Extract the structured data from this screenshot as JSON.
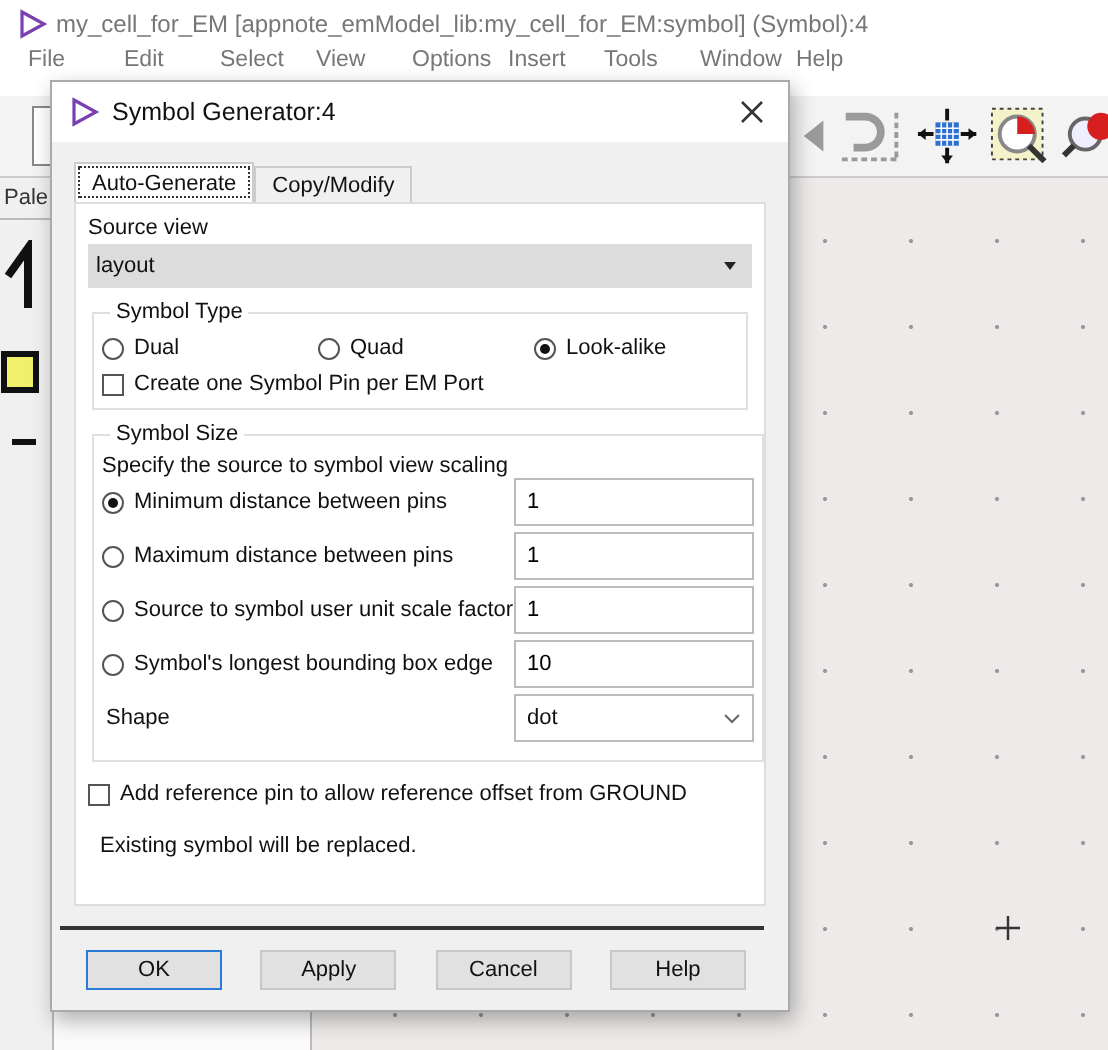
{
  "app_window": {
    "title": "my_cell_for_EM [appnote_emModel_lib:my_cell_for_EM:symbol] (Symbol):4",
    "menu": [
      "File",
      "Edit",
      "Select",
      "View",
      "Options",
      "Insert",
      "Tools",
      "Window",
      "Help"
    ],
    "palette_tab": "Pale"
  },
  "dialog": {
    "title": "Symbol Generator:4",
    "tabs": [
      {
        "label": "Auto-Generate",
        "selected": true
      },
      {
        "label": "Copy/Modify",
        "selected": false
      }
    ],
    "source_view": {
      "label": "Source view",
      "value": "layout"
    },
    "symbol_type": {
      "title": "Symbol Type",
      "options": [
        {
          "label": "Dual",
          "selected": false
        },
        {
          "label": "Quad",
          "selected": false
        },
        {
          "label": "Look-alike",
          "selected": true
        }
      ],
      "pin_per_port": {
        "label": "Create one Symbol Pin per EM Port",
        "checked": false
      }
    },
    "symbol_size": {
      "title": "Symbol Size",
      "hint": "Specify the source to symbol view scaling",
      "options": [
        {
          "label": "Minimum distance between pins",
          "selected": true,
          "value": "1"
        },
        {
          "label": "Maximum distance between pins",
          "selected": false,
          "value": "1"
        },
        {
          "label": "Source to symbol user unit scale factor",
          "selected": false,
          "value": "1"
        },
        {
          "label": "Symbol's longest bounding box edge",
          "selected": false,
          "value": "10"
        }
      ],
      "shape": {
        "label": "Shape",
        "value": "dot"
      }
    },
    "reference_pin": {
      "label": "Add reference pin to allow reference offset from GROUND",
      "checked": false
    },
    "note": "Existing symbol will be replaced.",
    "buttons": [
      {
        "label": "OK",
        "default": true
      },
      {
        "label": "Apply",
        "default": false
      },
      {
        "label": "Cancel",
        "default": false
      },
      {
        "label": "Help",
        "default": false
      }
    ]
  }
}
